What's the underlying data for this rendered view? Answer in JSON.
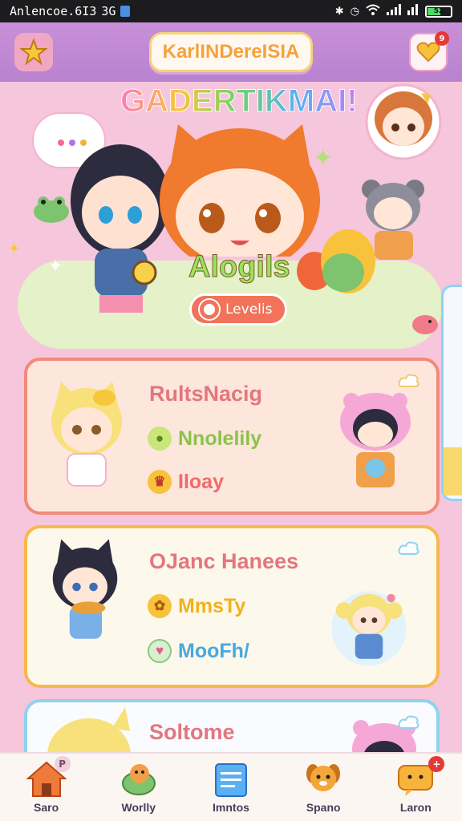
{
  "status_bar": {
    "carrier": "Anlencoe.6I3",
    "network": "3G",
    "battery": "52"
  },
  "app_bar": {
    "logo_text": "KarlINDereISIA",
    "notification_count": "9"
  },
  "hero": {
    "title": "GADERTIKMAI!",
    "badge_text": "Alogils",
    "levels_label": "Levelis"
  },
  "cards": [
    {
      "title": "RultsNacig",
      "rows": [
        {
          "label": "Nnolelily",
          "color": "#8bc34a"
        },
        {
          "label": "Iloay",
          "color": "#f06a6a"
        }
      ]
    },
    {
      "title": "OJanc Hanees",
      "rows": [
        {
          "label": "MmsTy",
          "color": "#f0b21b"
        },
        {
          "label": "MooFh/",
          "color": "#48a8e0"
        }
      ]
    },
    {
      "title": "Soltome",
      "rows": []
    }
  ],
  "bottom_nav": {
    "items": [
      {
        "label": "Saro",
        "badge": "P",
        "icon": "house-icon"
      },
      {
        "label": "Worlly",
        "badge": "",
        "icon": "turtle-icon"
      },
      {
        "label": "Imntos",
        "badge": "",
        "icon": "calendar-icon"
      },
      {
        "label": "Spano",
        "badge": "",
        "icon": "dog-icon"
      },
      {
        "label": "Laron",
        "badge": "+",
        "icon": "chat-icon"
      }
    ]
  },
  "colors": {
    "background": "#f6c6dc",
    "app_bar": "#b982cf",
    "accent_red": "#e53935",
    "card1_border": "#f08a7a",
    "card2_border": "#f6b94b",
    "card3_border": "#8ed3f0"
  }
}
